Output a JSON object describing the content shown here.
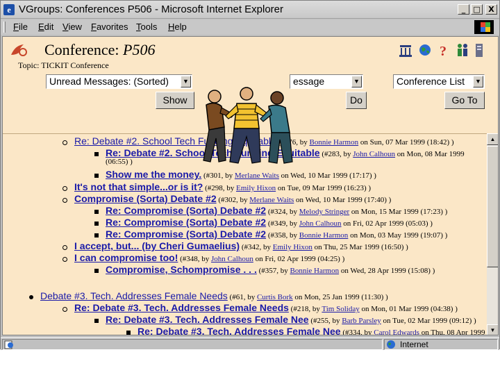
{
  "window": {
    "title": "VGroups: Conferences P506 - Microsoft Internet Explorer",
    "controls": {
      "minimize": "_",
      "maximize": "□",
      "close": "X"
    }
  },
  "menu": [
    "File",
    "Edit",
    "View",
    "Favorites",
    "Tools",
    "Help"
  ],
  "conference": {
    "heading": "Conference:",
    "name": "P506",
    "topic_label": "Topic:",
    "topic_value": "TICKIT Conference"
  },
  "toolbar": {
    "unread_select": "Unread Messages: (Sorted)",
    "message_select": "essage",
    "list_select": "Conference List",
    "show_button": "Show",
    "do_button": "Do",
    "goto_button": "Go To"
  },
  "messages": [
    {
      "subject": "Re: Debate #2. School Tech Funding Equitable",
      "meta_pre": "(#276, by ",
      "author": "Bonnie Harmon",
      "meta_post": " on Sun, 07 Mar 1999 (18:42) )"
    },
    {
      "subject": "Re: Debate #2. School Tech Funding Equitable",
      "meta_pre": "(#283, by ",
      "author": "John Calhoun",
      "meta_post": " on Mon, 08 Mar 1999",
      "meta_cont": "(06:55) )"
    },
    {
      "subject": "Show me the money.",
      "meta_pre": "(#301, by ",
      "author": "Merlane Waits",
      "meta_post": " on Wed, 10 Mar 1999 (17:17) )"
    },
    {
      "subject": "It's not that simple...or is it?",
      "meta_pre": "(#298, by ",
      "author": "Emily Hixon",
      "meta_post": " on Tue, 09 Mar 1999 (16:23) )"
    },
    {
      "subject": "Compromise (Sorta) Debate #2",
      "meta_pre": "(#302, by ",
      "author": "Merlane Waits",
      "meta_post": " on Wed, 10 Mar 1999 (17:40) )"
    },
    {
      "subject": "Re: Compromise (Sorta) Debate #2",
      "meta_pre": "(#324, by ",
      "author": "Melody Stringer",
      "meta_post": " on Mon, 15 Mar 1999 (17:23) )"
    },
    {
      "subject": "Re: Compromise (Sorta) Debate #2",
      "meta_pre": "(#349, by ",
      "author": "John Calhoun",
      "meta_post": " on Fri, 02 Apr 1999 (05:03) )"
    },
    {
      "subject": "Re: Compromise (Sorta) Debate #2",
      "meta_pre": "(#358, by ",
      "author": "Bonnie Harmon",
      "meta_post": " on Mon, 03 May 1999 (19:07) )"
    },
    {
      "subject": "I accept, but... (by Cheri Gumaelius)",
      "meta_pre": "(#342, by ",
      "author": "Emily Hixon",
      "meta_post": " on Thu, 25 Mar 1999 (16:50) )"
    },
    {
      "subject": "I can compromise too!",
      "meta_pre": "(#348, by ",
      "author": "John Calhoun",
      "meta_post": " on Fri, 02 Apr 1999 (04:25) )"
    },
    {
      "subject": "Compromise, Schompromise . . .",
      "meta_pre": "(#357, by ",
      "author": "Bonnie Harmon",
      "meta_post": " on Wed, 28 Apr 1999 (15:08) )"
    },
    {
      "subject": "Debate #3. Tech. Addresses Female Needs",
      "meta_pre": "(#61, by ",
      "author": "Curtis Bork",
      "meta_post": " on Mon, 25 Jan 1999 (11:30) )"
    },
    {
      "subject": "Re: Debate #3. Tech. Addresses Female Needs",
      "meta_pre": "(#218, by ",
      "author": "Tim Soliday",
      "meta_post": " on Mon, 01 Mar 1999 (04:38) )"
    },
    {
      "subject": "Re: Debate #3. Tech. Addresses Female Nee",
      "meta_pre": "(#255, by ",
      "author": "Barb Parsley",
      "meta_post": " on Tue, 02 Mar 1999 (09:12) )"
    },
    {
      "subject": "Re: Debate #3. Tech. Addresses Female Nee",
      "meta_pre": "(#334, by ",
      "author": "Carol Edwards",
      "meta_post": " on Thu, 08 Apr 1999"
    }
  ],
  "status": {
    "zone": "Internet"
  },
  "colors": {
    "page_bg": "#fbe7c7",
    "link": "#1a1aa8",
    "chrome": "#c0c0c0"
  }
}
